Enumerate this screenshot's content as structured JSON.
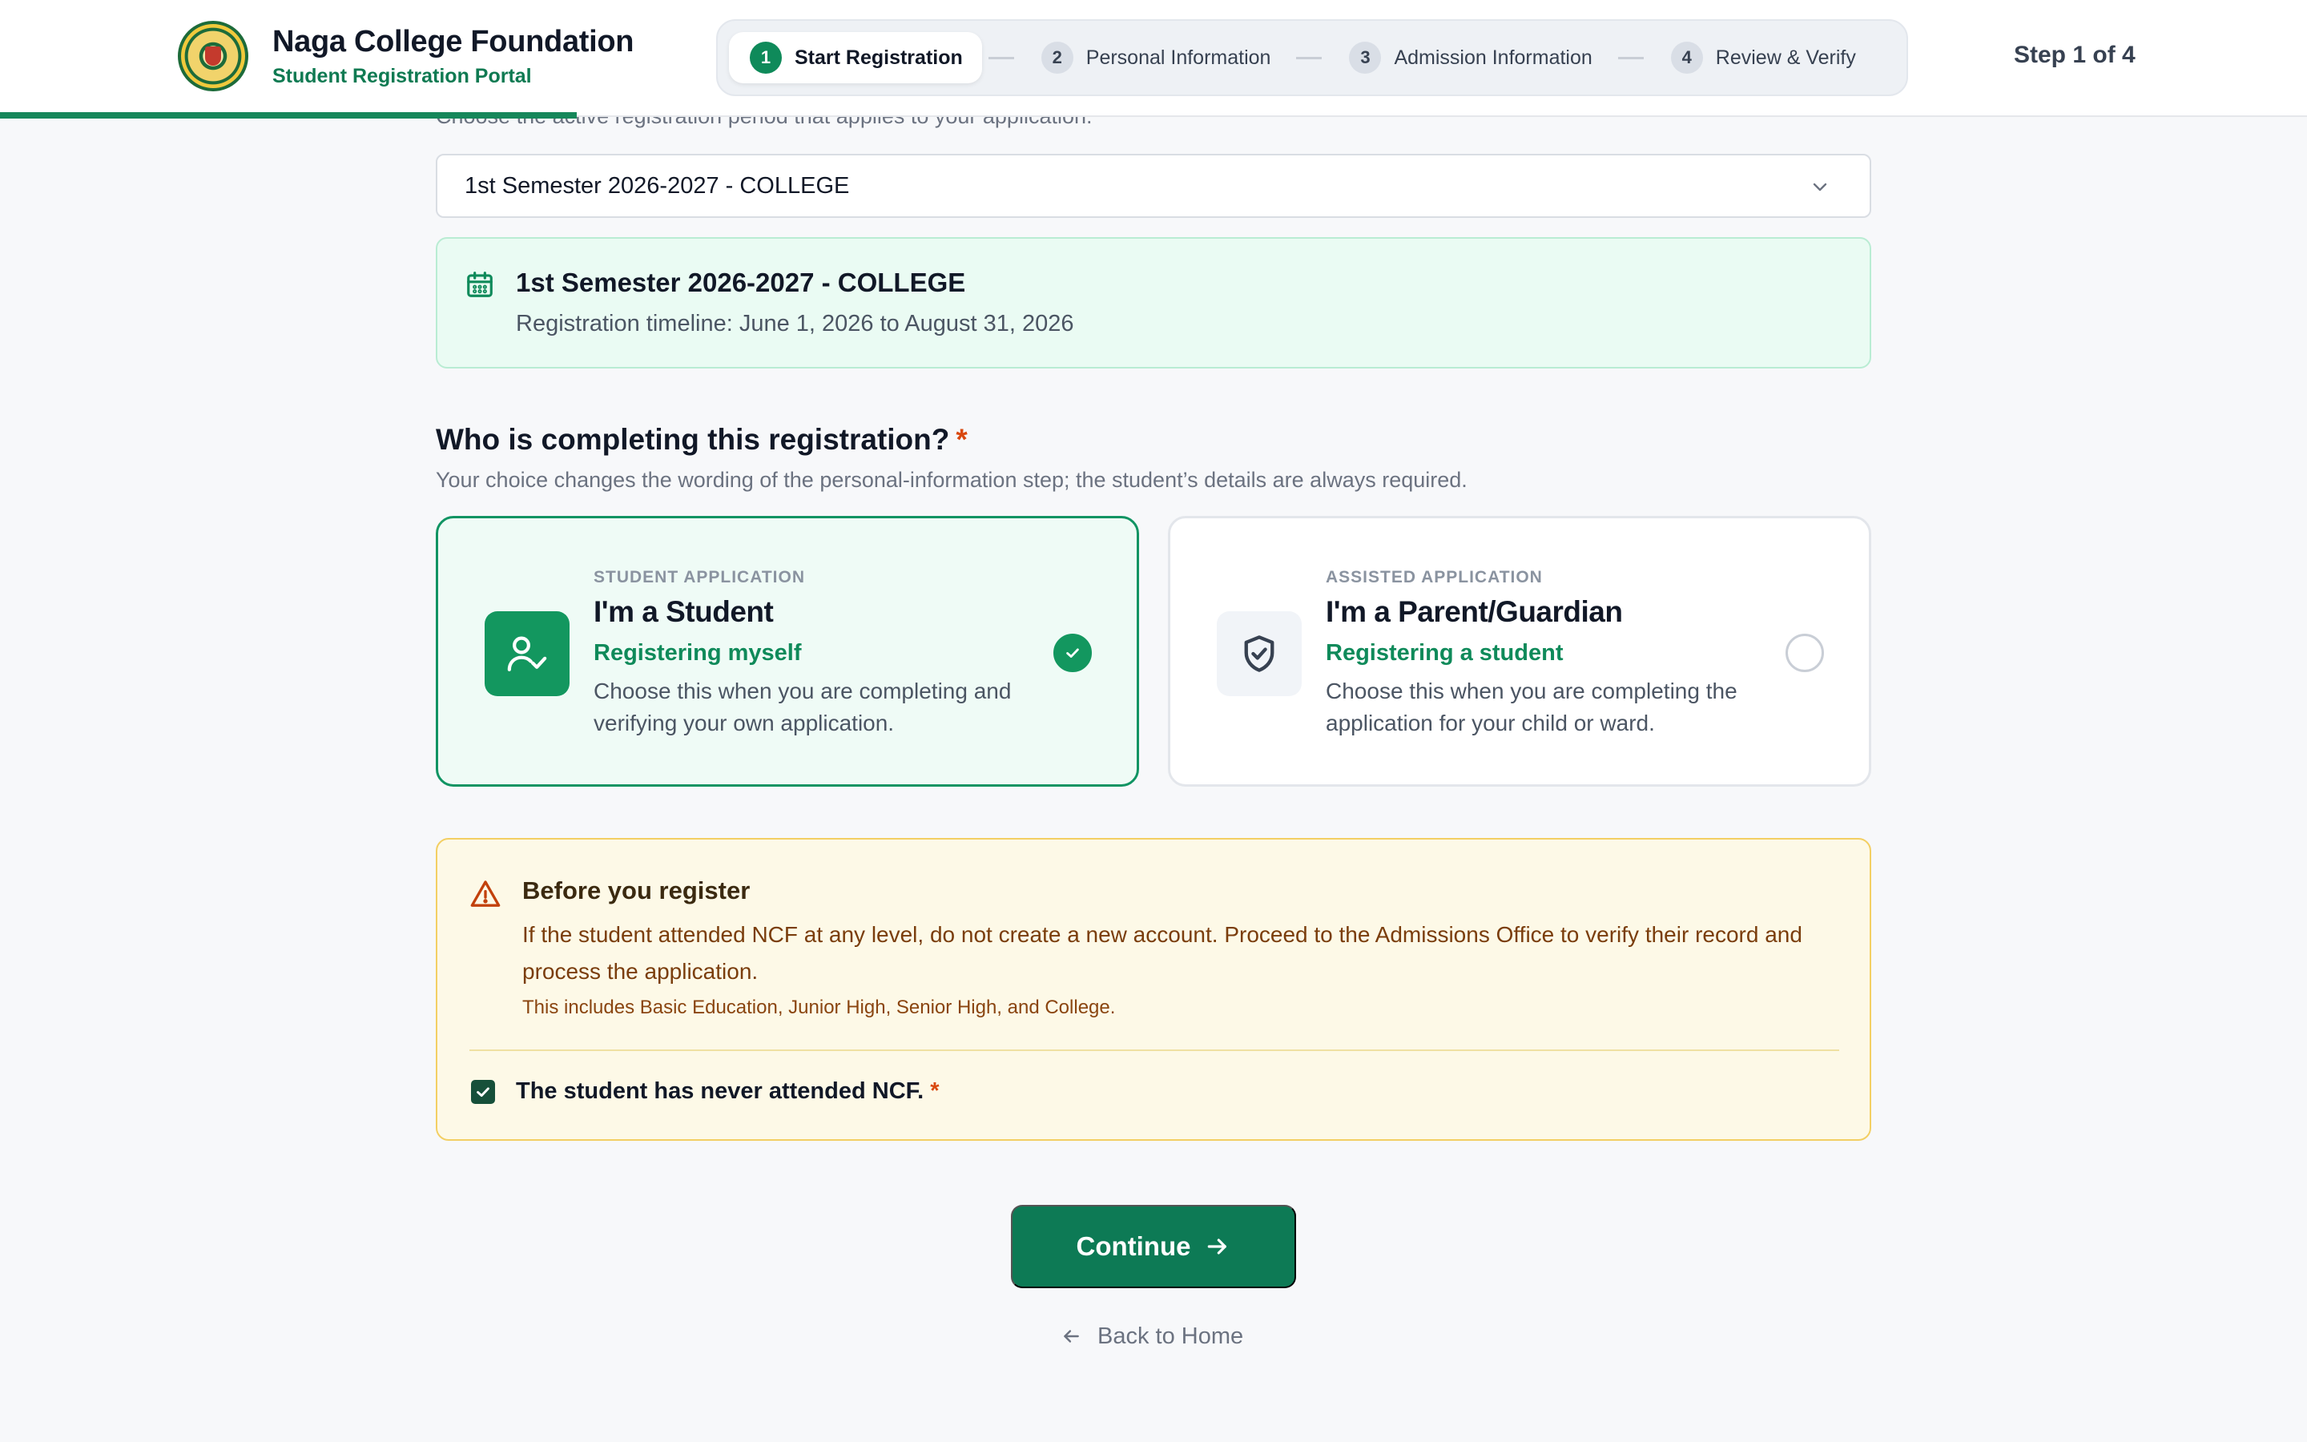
{
  "header": {
    "brand_title": "Naga College Foundation",
    "brand_subtitle": "Student Registration Portal",
    "step_count": "Step 1 of 4",
    "progress_fraction": 0.25,
    "steps": [
      {
        "num": "1",
        "label": "Start Registration",
        "active": true
      },
      {
        "num": "2",
        "label": "Personal Information",
        "active": false
      },
      {
        "num": "3",
        "label": "Admission Information",
        "active": false
      },
      {
        "num": "4",
        "label": "Review & Verify",
        "active": false
      }
    ]
  },
  "period": {
    "hint": "Choose the active registration period that applies to your application.",
    "selected": "1st Semester 2026-2027 - COLLEGE",
    "card_title": "1st Semester 2026-2027 - COLLEGE",
    "card_timeline": "Registration timeline: June 1, 2026 to August 31, 2026"
  },
  "role": {
    "question": "Who is completing this registration?",
    "required_mark": "*",
    "hint": "Your choice changes the wording of the personal-information step; the student’s details are always required.",
    "options": [
      {
        "eyebrow": "STUDENT APPLICATION",
        "title": "I'm a Student",
        "tag": "Registering myself",
        "description": "Choose this when you are completing and verifying your own application.",
        "icon": "user-check-icon",
        "selected": true
      },
      {
        "eyebrow": "ASSISTED APPLICATION",
        "title": "I'm a Parent/Guardian",
        "tag": "Registering a student",
        "description": "Choose this when you are completing the application for your child or ward.",
        "icon": "shield-check-icon",
        "selected": false
      }
    ]
  },
  "notice": {
    "title": "Before you register",
    "body": "If the student attended NCF at any level, do not create a new account. Proceed to the Admissions Office to verify their record and process the application.",
    "note": "This includes Basic Education, Junior High, Senior High, and College.",
    "checkbox_label": "The student has never attended NCF.",
    "checkbox_checked": true,
    "required_mark": "*"
  },
  "actions": {
    "continue_label": "Continue",
    "back_label": "Back to Home"
  },
  "colors": {
    "brand_green": "#0d7a55",
    "accent_green": "#13975f",
    "warning_border": "#f3cf63",
    "required_red": "#d9480f"
  }
}
